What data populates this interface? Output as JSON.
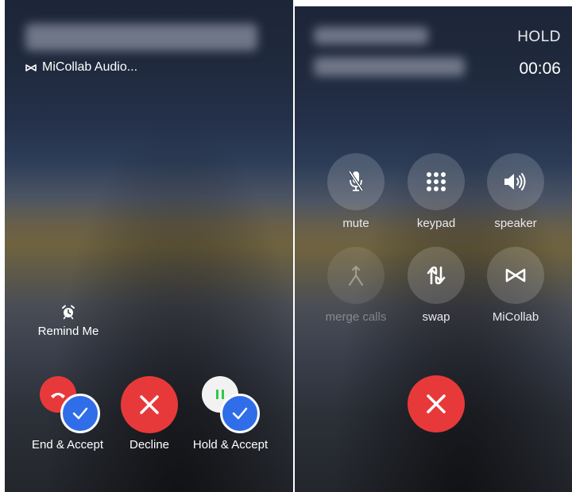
{
  "incoming": {
    "app_label": "MiCollab Audio...",
    "remind_label": "Remind Me",
    "actions": [
      {
        "label": "End & Accept"
      },
      {
        "label": "Decline"
      },
      {
        "label": "Hold & Accept"
      }
    ]
  },
  "ongoing": {
    "status": "HOLD",
    "timer": "00:06",
    "controls": [
      {
        "label": "mute",
        "icon": "mic-slash-icon",
        "enabled": true
      },
      {
        "label": "keypad",
        "icon": "keypad-icon",
        "enabled": true
      },
      {
        "label": "speaker",
        "icon": "speaker-icon",
        "enabled": true
      },
      {
        "label": "merge calls",
        "icon": "merge-icon",
        "enabled": false
      },
      {
        "label": "swap",
        "icon": "swap-icon",
        "enabled": true
      },
      {
        "label": "MiCollab",
        "icon": "micollab-icon",
        "enabled": true
      }
    ]
  },
  "colors": {
    "decline_red": "#e8393a",
    "accept_blue": "#2f6ee8",
    "hold_green": "#2ec94a"
  }
}
